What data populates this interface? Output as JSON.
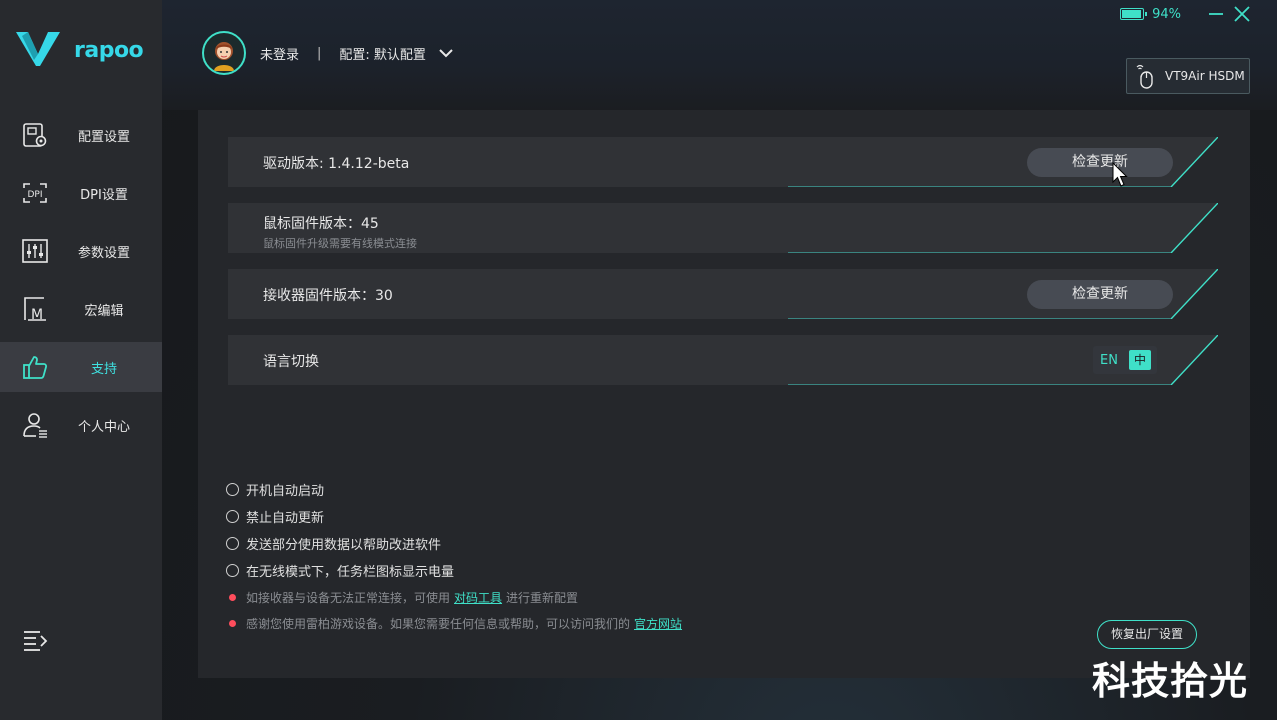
{
  "app": {
    "brand": "rapoo",
    "accent": "#3fe0c8"
  },
  "titlebar": {
    "battery_percent": 94,
    "battery_text": "94%"
  },
  "header": {
    "user_status": "未登录",
    "separator": "|",
    "profile_label": "配置: 默认配置",
    "device_name": "VT9Air HSDM"
  },
  "sidebar": {
    "items": [
      {
        "label": "配置设置",
        "icon": "config-icon",
        "active": false
      },
      {
        "label": "DPI设置",
        "icon": "dpi-icon",
        "active": false
      },
      {
        "label": "参数设置",
        "icon": "sliders-icon",
        "active": false
      },
      {
        "label": "宏编辑",
        "icon": "macro-icon",
        "active": false
      },
      {
        "label": "支持",
        "icon": "thumbs-up-icon",
        "active": true
      },
      {
        "label": "个人中心",
        "icon": "user-icon",
        "active": false
      }
    ]
  },
  "support": {
    "driver_version": "驱动版本: 1.4.12-beta",
    "check_update_label": "检查更新",
    "mouse_fw": "鼠标固件版本：45",
    "mouse_fw_note": "鼠标固件升级需要有线模式连接",
    "receiver_fw": "接收器固件版本：30",
    "check_update_label_2": "检查更新",
    "language_label": "语言切换",
    "lang_en": "EN",
    "lang_zh": "中"
  },
  "options": [
    "开机自动启动",
    "禁止自动更新",
    "发送部分使用数据以帮助改进软件",
    "在无线模式下，任务栏图标显示电量"
  ],
  "notes": {
    "pair_prefix": "如接收器与设备无法正常连接，可使用",
    "pair_link": "对码工具",
    "pair_suffix": "进行重新配置",
    "thanks_prefix": "感谢您使用雷柏游戏设备。如果您需要任何信息或帮助，可以访问我们的",
    "thanks_link": "官方网站"
  },
  "reset_label": "恢复出厂设置",
  "watermark": "科技拾光"
}
